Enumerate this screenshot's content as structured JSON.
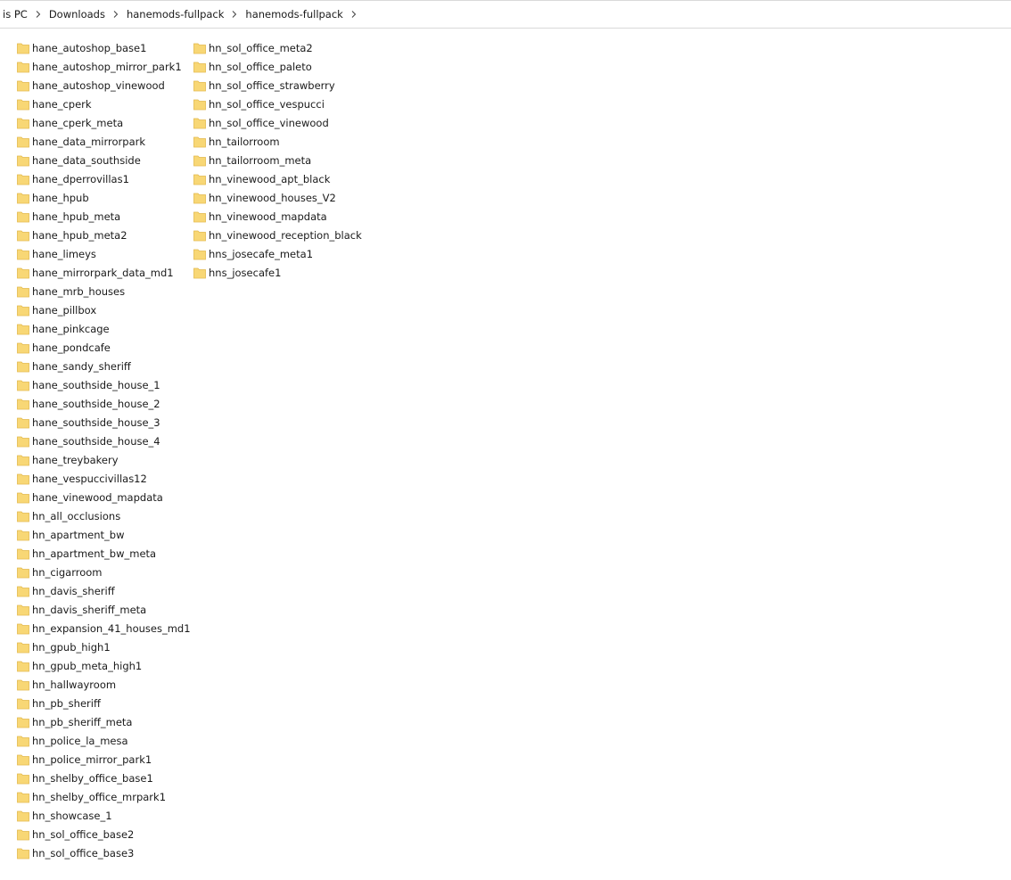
{
  "breadcrumb": {
    "items": [
      "is PC",
      "Downloads",
      "hanemods-fullpack",
      "hanemods-fullpack"
    ]
  },
  "colors": {
    "folder": "#F8D775",
    "folder_dark": "#E2B84A",
    "separator": "#d9d9d9"
  },
  "folders": {
    "column1": [
      "hane_autoshop_base1",
      "hane_autoshop_mirror_park1",
      "hane_autoshop_vinewood",
      "hane_cperk",
      "hane_cperk_meta",
      "hane_data_mirrorpark",
      "hane_data_southside",
      "hane_dperrovillas1",
      "hane_hpub",
      "hane_hpub_meta",
      "hane_hpub_meta2",
      "hane_limeys",
      "hane_mirrorpark_data_md1",
      "hane_mrb_houses",
      "hane_pillbox",
      "hane_pinkcage",
      "hane_pondcafe",
      "hane_sandy_sheriff",
      "hane_southside_house_1",
      "hane_southside_house_2",
      "hane_southside_house_3",
      "hane_southside_house_4",
      "hane_treybakery",
      "hane_vespuccivillas12",
      "hane_vinewood_mapdata",
      "hn_all_occlusions",
      "hn_apartment_bw",
      "hn_apartment_bw_meta",
      "hn_cigarroom",
      "hn_davis_sheriff",
      "hn_davis_sheriff_meta",
      "hn_expansion_41_houses_md1",
      "hn_gpub_high1",
      "hn_gpub_meta_high1",
      "hn_hallwayroom",
      "hn_pb_sheriff",
      "hn_pb_sheriff_meta",
      "hn_police_la_mesa",
      "hn_police_mirror_park1",
      "hn_shelby_office_base1",
      "hn_shelby_office_mrpark1",
      "hn_showcase_1",
      "hn_sol_office_base2",
      "hn_sol_office_base3"
    ],
    "column2": [
      "hn_sol_office_meta2",
      "hn_sol_office_paleto",
      "hn_sol_office_strawberry",
      "hn_sol_office_vespucci",
      "hn_sol_office_vinewood",
      "hn_tailorroom",
      "hn_tailorroom_meta",
      "hn_vinewood_apt_black",
      "hn_vinewood_houses_V2",
      "hn_vinewood_mapdata",
      "hn_vinewood_reception_black",
      "hns_josecafe_meta1",
      "hns_josecafe1"
    ]
  }
}
